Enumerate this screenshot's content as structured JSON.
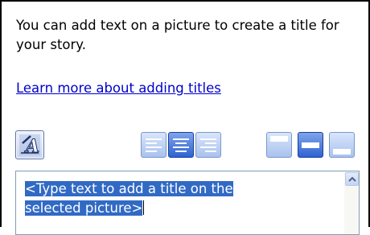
{
  "description": "You can add text on a picture to create a title for your story.",
  "learn_more_link": "Learn more about adding titles",
  "toolbar": {
    "font_button_icon": "font-settings-icon",
    "align_buttons": [
      {
        "name": "align-left-button",
        "icon": "align-left-icon",
        "selected": false
      },
      {
        "name": "align-center-button",
        "icon": "align-center-icon",
        "selected": true
      },
      {
        "name": "align-right-button",
        "icon": "align-right-icon",
        "selected": false
      }
    ],
    "position_buttons": [
      {
        "name": "position-top-button",
        "icon": "position-top-icon",
        "selected": false
      },
      {
        "name": "position-middle-button",
        "icon": "position-middle-icon",
        "selected": true
      },
      {
        "name": "position-bottom-button",
        "icon": "position-bottom-icon",
        "selected": false
      }
    ]
  },
  "title_input": {
    "value": "<Type text to add a title on the selected picture>",
    "selected": true
  },
  "colors": {
    "selection": "#316ac5",
    "link": "#0000cc",
    "button_selected": "#2f63d3",
    "button_normal": "#a9c2ee"
  }
}
